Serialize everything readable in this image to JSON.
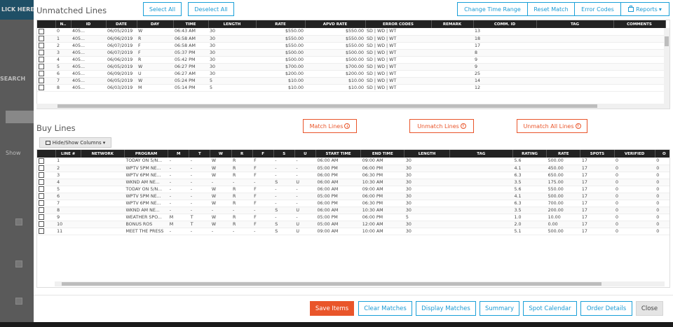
{
  "background": {
    "top_text": "LICK HERE T",
    "search_text": "SEARCH",
    "show_text": "Show"
  },
  "unmatched": {
    "title": "Unmatched Lines",
    "select_all": "Select All",
    "deselect_all": "Deselect All",
    "change_time_range": "Change Time Range",
    "reset_match": "Reset Match",
    "error_codes": "Error Codes",
    "reports": "Reports",
    "columns": [
      "N..",
      "ID",
      "DATE",
      "DAY",
      "TIME",
      "LENGTH",
      "RATE",
      "APVD RATE",
      "ERROR CODES",
      "REMARK",
      "COMM. ID",
      "TAG",
      "COMMENTS"
    ],
    "rows": [
      [
        "0",
        "405...",
        "06/05/2019",
        "W",
        "06:43 AM",
        "30",
        "$550.00",
        "$550.00",
        "SD | WD | WT",
        "",
        "13",
        "",
        ""
      ],
      [
        "1",
        "405...",
        "06/06/2019",
        "R",
        "06:58 AM",
        "30",
        "$550.00",
        "$550.00",
        "SD | WD | WT",
        "",
        "18",
        "",
        ""
      ],
      [
        "2",
        "405...",
        "06/07/2019",
        "F",
        "06:58 AM",
        "30",
        "$550.00",
        "$550.00",
        "SD | WD | WT",
        "",
        "17",
        "",
        ""
      ],
      [
        "3",
        "405...",
        "06/07/2019",
        "F",
        "05:37 PM",
        "30",
        "$500.00",
        "$500.00",
        "SD | WD | WT",
        "",
        "8",
        "",
        ""
      ],
      [
        "4",
        "405...",
        "06/06/2019",
        "R",
        "05:42 PM",
        "30",
        "$500.00",
        "$500.00",
        "SD | WD | WT",
        "",
        "9",
        "",
        ""
      ],
      [
        "5",
        "405...",
        "06/05/2019",
        "W",
        "06:27 PM",
        "30",
        "$700.00",
        "$700.00",
        "SD | WD | WT",
        "",
        "9",
        "",
        ""
      ],
      [
        "6",
        "405...",
        "06/09/2019",
        "U",
        "06:27 AM",
        "30",
        "$200.00",
        "$200.00",
        "SD | WD | WT",
        "",
        "25",
        "",
        ""
      ],
      [
        "7",
        "405...",
        "06/05/2019",
        "W",
        "05:24 PM",
        "5",
        "$10.00",
        "$10.00",
        "SD | WD | WT",
        "",
        "14",
        "",
        ""
      ],
      [
        "8",
        "405...",
        "06/03/2019",
        "M",
        "05:14 PM",
        "5",
        "$10.00",
        "$10.00",
        "SD | WD | WT",
        "",
        "12",
        "",
        ""
      ]
    ]
  },
  "buy": {
    "title": "Buy Lines",
    "hide_show_columns": "Hide/Show Columns",
    "match_lines": "Match Lines",
    "unmatch_lines": "Unmatch Lines",
    "unmatch_all_lines": "Unmatch All Lines",
    "columns": [
      "LINE #",
      "NETWORK",
      "PROGRAM",
      "M",
      "T",
      "W",
      "R",
      "F",
      "S",
      "U",
      "START TIME",
      "END TIME",
      "LENGTH",
      "TAG",
      "RATING",
      "RATE",
      "SPOTS",
      "VERIFIED",
      "O"
    ],
    "rows": [
      [
        "1",
        "",
        "TODAY ON 5/N...",
        "-",
        "-",
        "W",
        "R",
        "F",
        "-",
        "-",
        "06:00 AM",
        "09:00 AM",
        "30",
        "",
        "5.6",
        "500.00",
        "17",
        "0",
        "0"
      ],
      [
        "2",
        "",
        "WPTV 5PM NE...",
        "-",
        "-",
        "W",
        "R",
        "F",
        "-",
        "-",
        "05:00 PM",
        "06:00 PM",
        "30",
        "",
        "4.1",
        "450.00",
        "17",
        "0",
        "0"
      ],
      [
        "3",
        "",
        "WPTV 6PM NE...",
        "-",
        "-",
        "W",
        "R",
        "F",
        "-",
        "-",
        "06:00 PM",
        "06:30 PM",
        "30",
        "",
        "6.3",
        "650.00",
        "17",
        "0",
        "0"
      ],
      [
        "4",
        "",
        "WKND AM NE...",
        "-",
        "-",
        "-",
        "-",
        "-",
        "S",
        "U",
        "06:00 AM",
        "10:30 AM",
        "30",
        "",
        "3.5",
        "175.00",
        "17",
        "0",
        "0"
      ],
      [
        "5",
        "",
        "TODAY ON 5/N...",
        "-",
        "-",
        "W",
        "R",
        "F",
        "-",
        "-",
        "06:00 AM",
        "09:00 AM",
        "30",
        "",
        "5.6",
        "550.00",
        "17",
        "0",
        "0"
      ],
      [
        "6",
        "",
        "WPTV 5PM NE...",
        "-",
        "-",
        "W",
        "R",
        "F",
        "-",
        "-",
        "05:00 PM",
        "06:00 PM",
        "30",
        "",
        "4.1",
        "500.00",
        "17",
        "0",
        "0"
      ],
      [
        "7",
        "",
        "WPTV 6PM NE...",
        "-",
        "-",
        "W",
        "R",
        "F",
        "-",
        "-",
        "06:00 PM",
        "06:30 PM",
        "30",
        "",
        "6.3",
        "700.00",
        "17",
        "0",
        "0"
      ],
      [
        "8",
        "",
        "WKND AM NE...",
        "-",
        "-",
        "-",
        "-",
        "-",
        "S",
        "U",
        "06:00 AM",
        "10:30 AM",
        "30",
        "",
        "3.5",
        "200.00",
        "17",
        "0",
        "0"
      ],
      [
        "9",
        "",
        "WEATHER SPO...",
        "M",
        "T",
        "W",
        "R",
        "F",
        "-",
        "-",
        "05:00 PM",
        "06:00 PM",
        "5",
        "",
        "1.0",
        "10.00",
        "17",
        "0",
        "0"
      ],
      [
        "10",
        "",
        "BONUS ROS",
        "M",
        "T",
        "W",
        "R",
        "F",
        "S",
        "U",
        "05:00 AM",
        "12:00 AM",
        "30",
        "",
        "2.0",
        "0.00",
        "17",
        "0",
        "0"
      ],
      [
        "11",
        "",
        "MEET THE PRESS",
        "-",
        "-",
        "-",
        "-",
        "-",
        "S",
        "U",
        "09:00 AM",
        "10:00 AM",
        "30",
        "",
        "5.1",
        "500.00",
        "17",
        "0",
        "0"
      ]
    ]
  },
  "footer": {
    "save_items": "Save Items",
    "clear_matches": "Clear Matches",
    "display_matches": "Display Matches",
    "summary": "Summary",
    "spot_calendar": "Spot Calendar",
    "order_details": "Order Details",
    "close": "Close"
  },
  "colors": {
    "accent": "#1aa0d8",
    "orange": "#e9552a",
    "header_bg": "#222222"
  },
  "icons": {
    "reports": "printer-icon",
    "match": "arrow-down-circle-icon",
    "unmatch": "arrow-up-circle-icon",
    "columns": "columns-icon"
  }
}
